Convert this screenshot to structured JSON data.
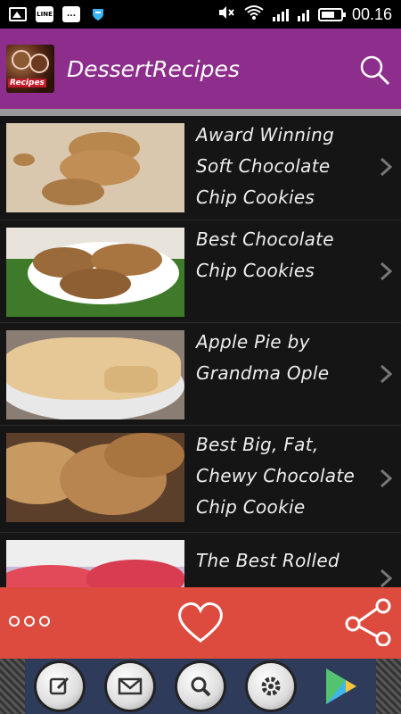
{
  "status_bar": {
    "time": "00.16",
    "line_icon": "LINE",
    "chat_icon": "...",
    "icons": [
      "image-icon",
      "line-icon",
      "chat-icon",
      "shield-icon",
      "mute-icon",
      "wifi-icon",
      "signal-icon",
      "battery-icon"
    ]
  },
  "app_bar": {
    "title": "DessertRecipes",
    "logo_text": "Recipes",
    "search_icon": "search-icon",
    "background": "#8d2d8c"
  },
  "recipes": [
    {
      "title": "Award Winning Soft Chocolate Chip Cookies"
    },
    {
      "title": "Best Chocolate Chip Cookies"
    },
    {
      "title": "Apple Pie by Grandma Ople"
    },
    {
      "title": "Best Big, Fat, Chewy Chocolate Chip Cookie"
    },
    {
      "title": "The Best Rolled"
    }
  ],
  "bottom_bar": {
    "background": "#dc4b3e",
    "more_icon": "more-dots-icon",
    "favorite_icon": "heart-icon",
    "share_icon": "share-icon"
  },
  "dock": {
    "icons": [
      "compose-icon",
      "mail-icon",
      "search-icon",
      "settings-icon",
      "play-store-icon"
    ]
  }
}
